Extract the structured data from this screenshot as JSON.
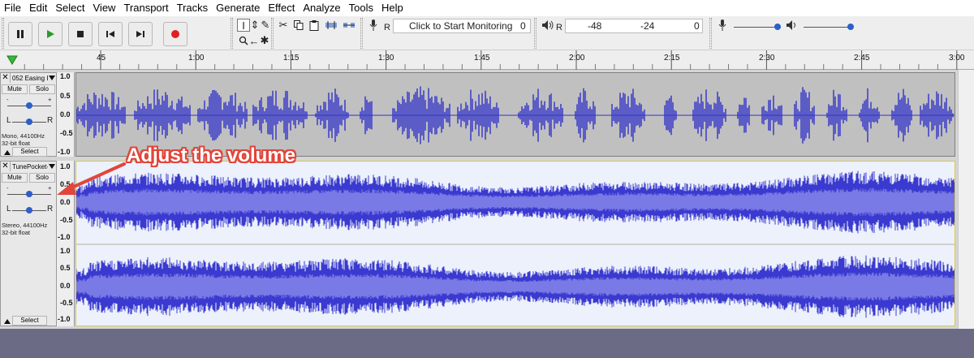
{
  "menu": [
    "File",
    "Edit",
    "Select",
    "View",
    "Transport",
    "Tracks",
    "Generate",
    "Effect",
    "Analyze",
    "Tools",
    "Help"
  ],
  "toolbar": {
    "monitor_label": "Click to Start Monitoring",
    "monitor_value": "0",
    "playback_meter_ticks": [
      "-48",
      "-24",
      "0"
    ],
    "record_meter_letter": "R",
    "playback_meter_letter": "R",
    "colors": {
      "record": "#e02020",
      "play": "#2a9b2a",
      "accent": "#2d5fc9"
    }
  },
  "ruler": {
    "ticks": [
      "45",
      "1:00",
      "1:15",
      "1:30",
      "1:45",
      "2:00",
      "2:15",
      "2:30",
      "2:45",
      "3:00"
    ]
  },
  "tracks": [
    {
      "name": "052 Easing I",
      "mute": "Mute",
      "solo": "Solo",
      "gain_minus": "-",
      "gain_plus": "+",
      "pan_left": "L",
      "pan_right": "R",
      "info_line1": "Mono, 44100Hz",
      "info_line2": "32-bit float",
      "select": "Select",
      "scale": [
        "1.0",
        "0.5",
        "0.0",
        "-0.5",
        "-1.0"
      ],
      "selected": false
    },
    {
      "name": "TunePocket-",
      "mute": "Mute",
      "solo": "Solo",
      "gain_minus": "-",
      "gain_plus": "+",
      "pan_left": "L",
      "pan_right": "R",
      "info_line1": "Stereo, 44100Hz",
      "info_line2": "32-bit float",
      "select": "Select",
      "scale_top": [
        "1.0",
        "0.5",
        "0.0",
        "-0.5",
        "-1.0"
      ],
      "scale_bottom": [
        "1.0",
        "0.5",
        "0.0",
        "-0.5",
        "-1.0"
      ],
      "selected": true
    }
  ],
  "annotation": {
    "text": "Adjust the volume",
    "color": "#e2453a"
  }
}
